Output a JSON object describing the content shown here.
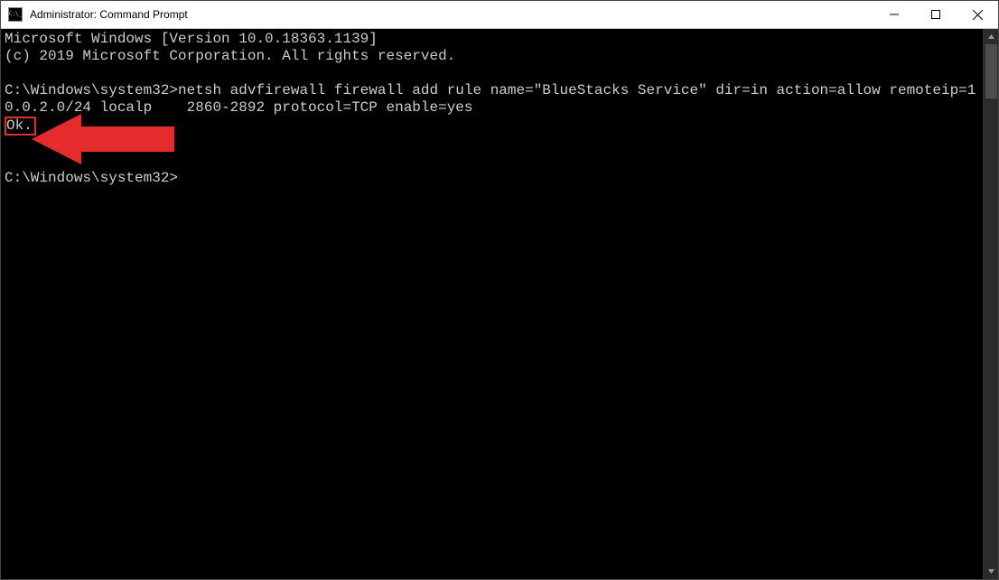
{
  "window": {
    "title": "Administrator: Command Prompt"
  },
  "terminal": {
    "header_line1": "Microsoft Windows [Version 10.0.18363.1139]",
    "header_line2": "(c) 2019 Microsoft Corporation. All rights reserved.",
    "prompt1": "C:\\Windows\\system32>",
    "command_part1": "netsh advfirewall firewall add rule name=\"BlueStacks Service\" dir=in action=allow remoteip=10.0.2.0/24 localp",
    "command_obscured_mid": "2860-2892",
    "command_part2": " protocol=TCP enable=yes",
    "result": "Ok.",
    "prompt2": "C:\\Windows\\system32>"
  },
  "annotation": {
    "arrow_color": "#e52b2b"
  }
}
